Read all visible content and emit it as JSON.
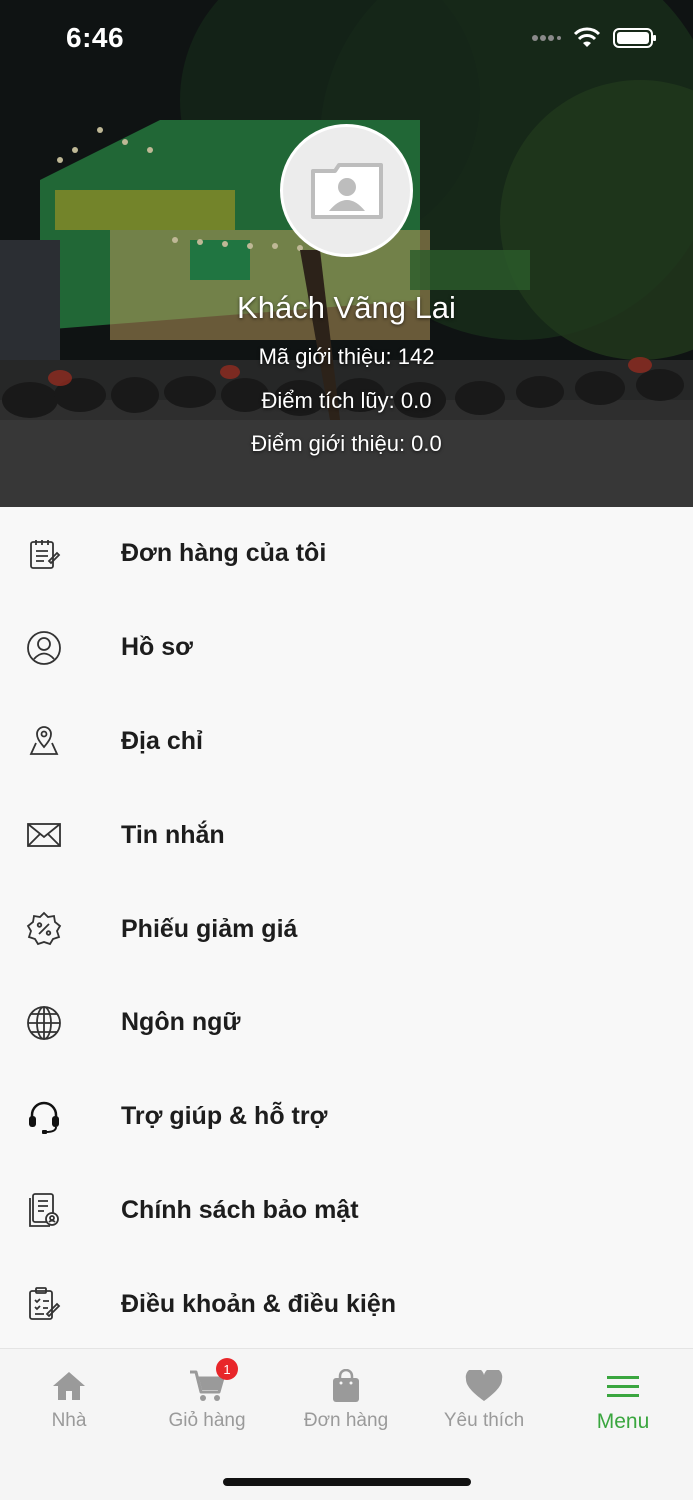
{
  "status_bar": {
    "time": "6:46"
  },
  "profile": {
    "name": "Khách Vãng Lai",
    "referral_code": "Mã giới thiệu: 142",
    "points": "Điểm tích lũy: 0.0",
    "referral_points": "Điểm giới thiệu: 0.0"
  },
  "menu": {
    "items": [
      {
        "label": "Đơn hàng của tôi",
        "icon": "order-list-icon"
      },
      {
        "label": "Hồ sơ",
        "icon": "profile-icon"
      },
      {
        "label": "Địa chỉ",
        "icon": "map-pin-icon"
      },
      {
        "label": "Tin nhắn",
        "icon": "mail-icon"
      },
      {
        "label": "Phiếu giảm giá",
        "icon": "discount-badge-icon"
      },
      {
        "label": "Ngôn ngữ",
        "icon": "globe-icon"
      },
      {
        "label": "Trợ giúp & hỗ trợ",
        "icon": "headset-icon"
      },
      {
        "label": "Chính sách bảo mật",
        "icon": "privacy-document-icon"
      },
      {
        "label": "Điều khoản & điều kiện",
        "icon": "terms-clipboard-icon"
      }
    ]
  },
  "bottom_nav": {
    "items": [
      {
        "label": "Nhà",
        "icon": "home-icon"
      },
      {
        "label": "Giỏ hàng",
        "icon": "cart-icon",
        "badge": "1"
      },
      {
        "label": "Đơn hàng",
        "icon": "shopping-bag-icon"
      },
      {
        "label": "Yêu thích",
        "icon": "heart-icon"
      },
      {
        "label": "Menu",
        "icon": "hamburger-menu-icon",
        "active": true
      }
    ]
  },
  "colors": {
    "accent": "#3aa63f",
    "badge": "#e8262a",
    "inactive": "#9a9a9a"
  }
}
